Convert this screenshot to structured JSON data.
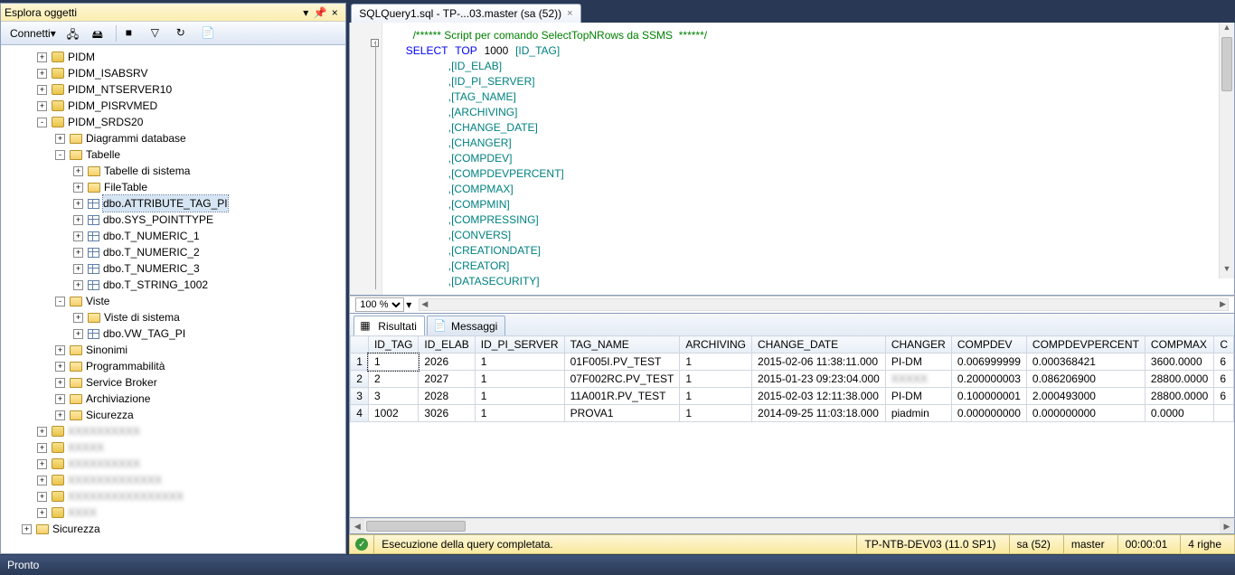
{
  "explorer": {
    "title": "Esplora oggetti",
    "connect": "Connetti",
    "nodes": {
      "pidm": "PIDM",
      "isabsrv": "PIDM_ISABSRV",
      "ntserver": "PIDM_NTSERVER10",
      "pisrvmed": "PIDM_PISRVMED",
      "srds20": "PIDM_SRDS20",
      "diagrams": "Diagrammi database",
      "tables": "Tabelle",
      "systables": "Tabelle di sistema",
      "filetable": "FileTable",
      "t_attr": "dbo.ATTRIBUTE_TAG_PI",
      "t_point": "dbo.SYS_POINTTYPE",
      "t_num1": "dbo.T_NUMERIC_1",
      "t_num2": "dbo.T_NUMERIC_2",
      "t_num3": "dbo.T_NUMERIC_3",
      "t_str": "dbo.T_STRING_1002",
      "views": "Viste",
      "sysviews": "Viste di sistema",
      "vw_tag": "dbo.VW_TAG_PI",
      "synonyms": "Sinonimi",
      "prog": "Programmabilità",
      "sb": "Service Broker",
      "arch": "Archiviazione",
      "sec": "Sicurezza",
      "sec2": "Sicurezza"
    }
  },
  "tab": {
    "title": "SQLQuery1.sql - TP-...03.master (sa (52))"
  },
  "sql": {
    "comment": "/****** Script per comando SelectTopNRows da SSMS  ******/",
    "select": "SELECT",
    "top": "TOP",
    "topn": "1000",
    "cols": [
      "[ID_TAG]",
      "[ID_ELAB]",
      "[ID_PI_SERVER]",
      "[TAG_NAME]",
      "[ARCHIVING]",
      "[CHANGE_DATE]",
      "[CHANGER]",
      "[COMPDEV]",
      "[COMPDEVPERCENT]",
      "[COMPMAX]",
      "[COMPMIN]",
      "[COMPRESSING]",
      "[CONVERS]",
      "[CREATIONDATE]",
      "[CREATOR]",
      "[DATASECURITY]"
    ]
  },
  "zoom": "100 %",
  "rtabs": {
    "results": "Risultati",
    "messages": "Messaggi"
  },
  "grid": {
    "headers": [
      "",
      "ID_TAG",
      "ID_ELAB",
      "ID_PI_SERVER",
      "TAG_NAME",
      "ARCHIVING",
      "CHANGE_DATE",
      "CHANGER",
      "COMPDEV",
      "COMPDEVPERCENT",
      "COMPMAX",
      "C"
    ],
    "rows": [
      [
        "1",
        "1",
        "2026",
        "1",
        "01F005I.PV_TEST",
        "1",
        "2015-02-06 11:38:11.000",
        "PI-DM",
        "0.006999999",
        "0.000368421",
        "3600.0000",
        "6"
      ],
      [
        "2",
        "2",
        "2027",
        "1",
        "07F002RC.PV_TEST",
        "1",
        "2015-01-23 09:23:04.000",
        "(blur)",
        "0.200000003",
        "0.086206900",
        "28800.0000",
        "6"
      ],
      [
        "3",
        "3",
        "2028",
        "1",
        "11A001R.PV_TEST",
        "1",
        "2015-02-03 12:11:38.000",
        "PI-DM",
        "0.100000001",
        "2.000493000",
        "28800.0000",
        "6"
      ],
      [
        "4",
        "1002",
        "3026",
        "1",
        "PROVA1",
        "1",
        "2014-09-25 11:03:18.000",
        "piadmin",
        "0.000000000",
        "0.000000000",
        "0.0000",
        ""
      ]
    ]
  },
  "status": {
    "msg": "Esecuzione della query completata.",
    "server": "TP-NTB-DEV03 (11.0 SP1)",
    "user": "sa (52)",
    "db": "master",
    "time": "00:00:01",
    "rows": "4 righe"
  },
  "bottom": "Pronto"
}
